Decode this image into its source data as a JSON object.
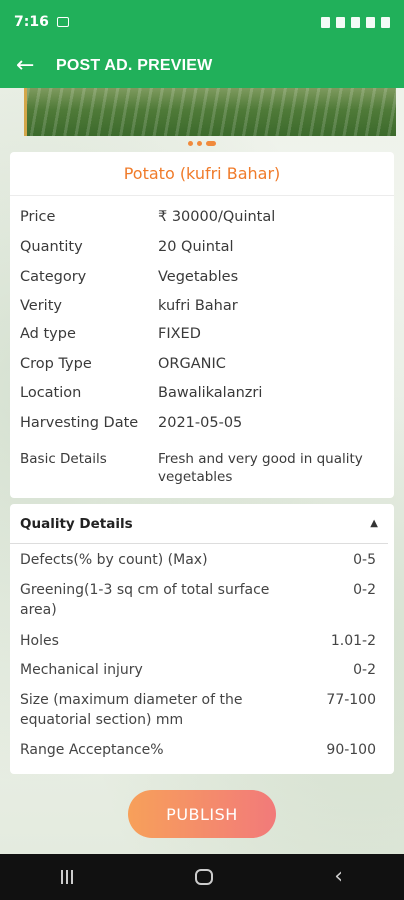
{
  "status_bar": {
    "time": "7:16"
  },
  "app_bar": {
    "title": "POST AD. PREVIEW"
  },
  "product": {
    "title": "Potato (kufri Bahar)",
    "details": [
      {
        "label": "Price",
        "value": "₹ 30000/Quintal"
      },
      {
        "label": "Quantity",
        "value": "20 Quintal"
      },
      {
        "label": "Category",
        "value": "Vegetables"
      },
      {
        "label": "Verity",
        "value": "kufri Bahar"
      },
      {
        "label": "Ad type",
        "value": "FIXED"
      },
      {
        "label": "Crop Type",
        "value": "ORGANIC"
      },
      {
        "label": "Location",
        "value": "Bawalikalanzri"
      },
      {
        "label": "Harvesting Date",
        "value": "2021-05-05"
      },
      {
        "label": "Basic Details",
        "value": "Fresh and very good in quality vegetables"
      }
    ]
  },
  "quality": {
    "header": "Quality Details",
    "rows": [
      {
        "label": "Defects(% by count) (Max)",
        "value": "0-5"
      },
      {
        "label": "Greening(1-3 sq cm of total surface area)",
        "value": "0-2"
      },
      {
        "label": "Holes",
        "value": "1.01-2"
      },
      {
        "label": "Mechanical injury",
        "value": "0-2"
      },
      {
        "label": "Size (maximum diameter of the equatorial section) mm",
        "value": "77-100"
      },
      {
        "label": "Range Acceptance%",
        "value": "90-100"
      }
    ]
  },
  "publish_label": "PUBLISH",
  "colors": {
    "primary": "#21b05a",
    "accent": "#f07b2a",
    "publish_start": "#f7a05a",
    "publish_end": "#f27a7a"
  }
}
